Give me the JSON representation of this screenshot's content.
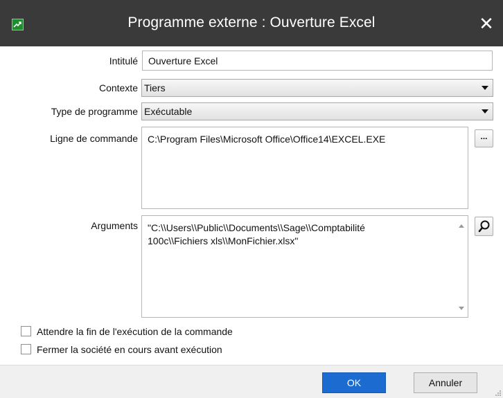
{
  "window": {
    "title": "Programme externe : Ouverture Excel",
    "close_glyph": "✕",
    "app_icon": "excel-chart-icon"
  },
  "form": {
    "intitule": {
      "label": "Intitulé",
      "value": "Ouverture Excel"
    },
    "contexte": {
      "label": "Contexte",
      "value": "Tiers"
    },
    "type_programme": {
      "label": "Type de programme",
      "value": "Exécutable"
    },
    "ligne_commande": {
      "label": "Ligne de commande",
      "value": "C:\\Program Files\\Microsoft Office\\Office14\\EXCEL.EXE",
      "browse_label": "..."
    },
    "arguments": {
      "label": "Arguments",
      "line1": "\"C:\\\\Users\\\\Public\\\\Documents\\\\Sage\\\\Comptabilité",
      "line2": "100c\\\\Fichiers xls\\\\MonFichier.xlsx\"",
      "search_icon": "magnifier-icon"
    },
    "options": [
      {
        "label": "Attendre la fin de l'exécution de la commande",
        "checked": false
      },
      {
        "label": "Fermer la société en cours avant exécution",
        "checked": false
      }
    ]
  },
  "buttons": {
    "ok": "OK",
    "cancel": "Annuler"
  },
  "colors": {
    "titlebar": "#3a3a3a",
    "accent": "#1b6bd0",
    "icon": "#1f8c2e"
  }
}
